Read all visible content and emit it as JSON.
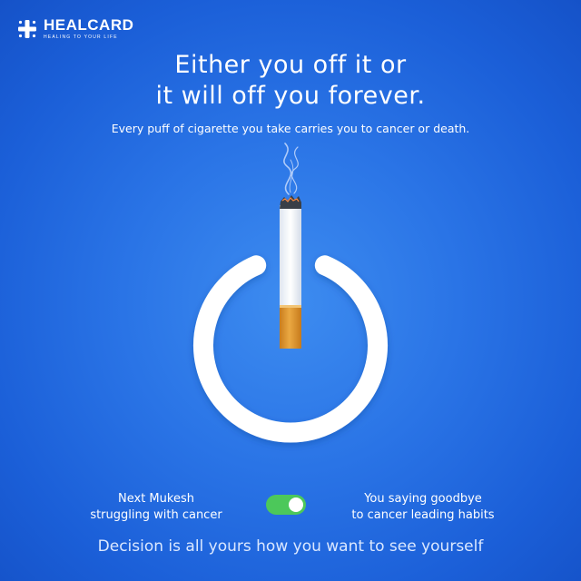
{
  "brand": {
    "name": "HEALCARD",
    "tagline": "HEALING TO YOUR LIFE"
  },
  "headline": {
    "line1": "Either you off it or",
    "line2": "it will off you forever."
  },
  "subtitle": "Every puff of cigarette you take carries you to cancer or death.",
  "graphic": {
    "icon": "power-icon",
    "cigarette": "cigarette-icon"
  },
  "toggle": {
    "left_label": [
      "Next Mukesh",
      "struggling with cancer"
    ],
    "right_label": [
      "You saying goodbye",
      "to cancer leading habits"
    ],
    "state": "on",
    "color": "#4cc85a"
  },
  "footer": "Decision is all yours how you want to see yourself",
  "colors": {
    "background": "#2a74e6",
    "ring": "#ffffff",
    "filter": "#e8a43a"
  }
}
